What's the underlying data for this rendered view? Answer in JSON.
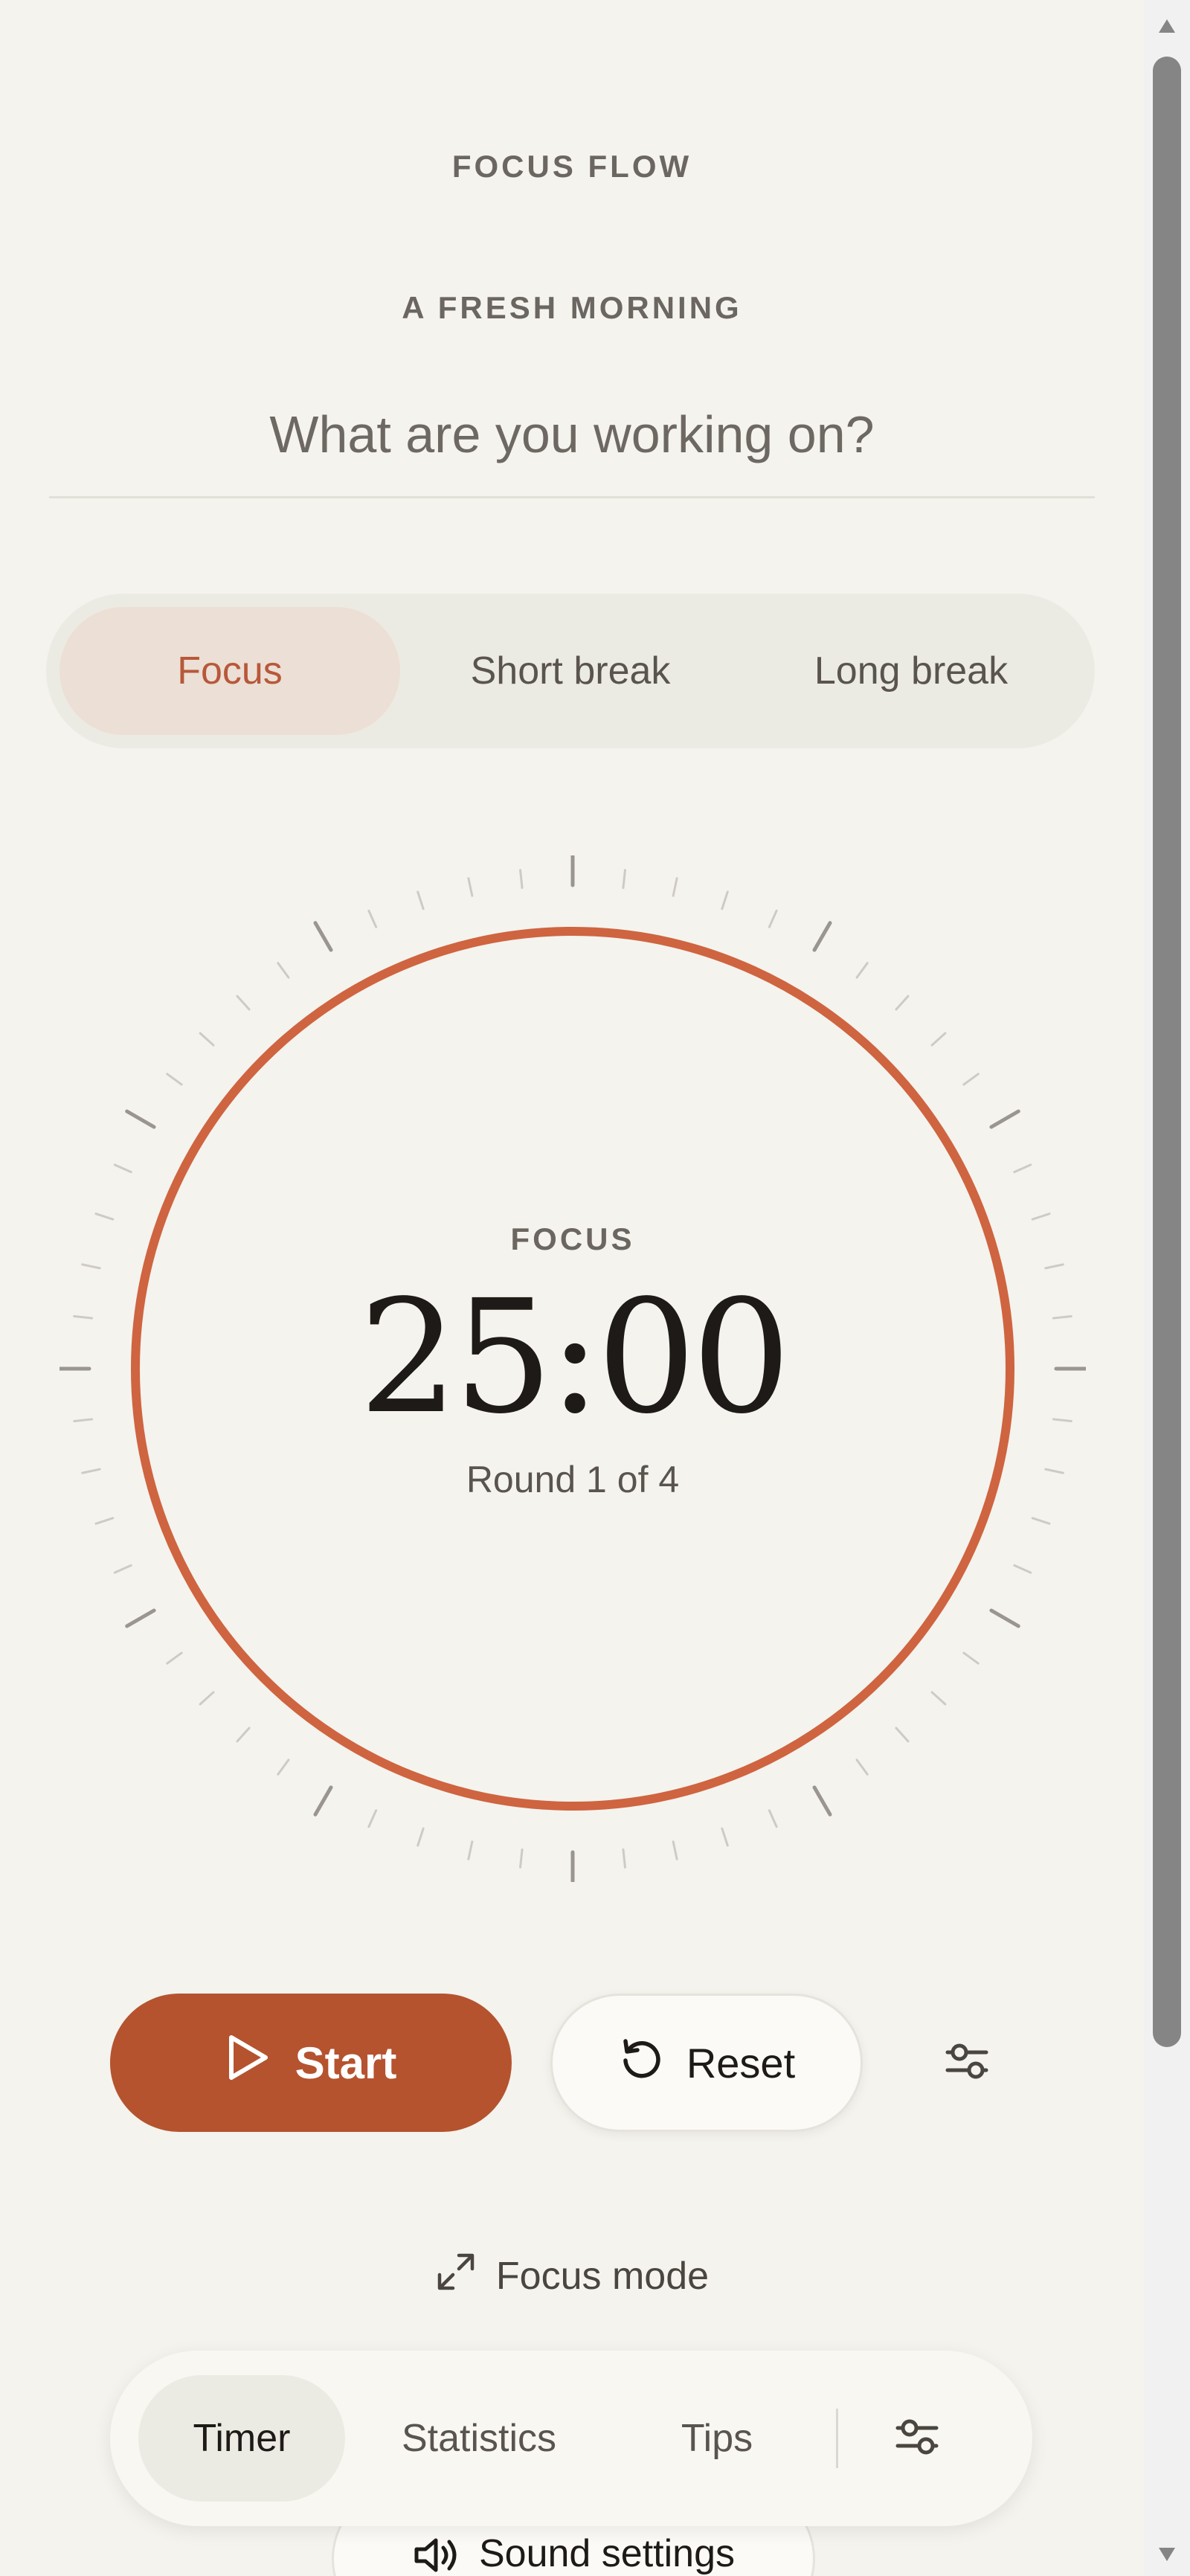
{
  "app": {
    "brand": "FOCUS FLOW",
    "greeting": "A FRESH MORNING",
    "task_placeholder": "What are you working on?"
  },
  "mode_tabs": [
    {
      "label": "Focus",
      "active": true
    },
    {
      "label": "Short break",
      "active": false
    },
    {
      "label": "Long break",
      "active": false
    }
  ],
  "timer": {
    "phase": "FOCUS",
    "time": "25:00",
    "round": "Round 1 of 4",
    "progress": 1.0
  },
  "controls": {
    "start_label": "Start",
    "reset_label": "Reset"
  },
  "focus_mode_label": "Focus mode",
  "bottom_nav": {
    "items": [
      {
        "label": "Timer",
        "active": true
      },
      {
        "label": "Statistics",
        "active": false
      },
      {
        "label": "Tips",
        "active": false
      }
    ]
  },
  "sound_settings_label": "Sound settings",
  "icons": {
    "start": "play-icon",
    "reset": "reset-icon",
    "tune": "sliders-icon",
    "focus_mode": "expand-icon",
    "sound": "speaker-icon"
  },
  "colors": {
    "accent": "#b5532f",
    "ring": "#cf6440",
    "background": "#f4f3ee",
    "tab_active_bg": "#ecdfd5",
    "tab_active_text": "#b7583a"
  }
}
